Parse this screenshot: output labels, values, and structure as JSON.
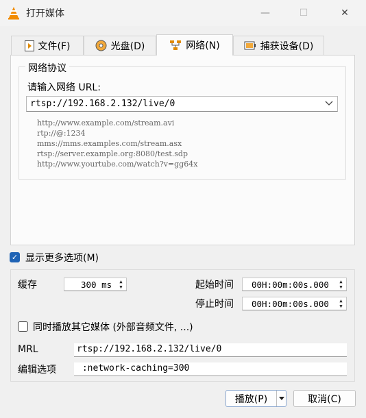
{
  "window": {
    "title": "打开媒体",
    "minimize": "—",
    "maximize": "☐",
    "close": "✕"
  },
  "tabs": [
    {
      "label": "文件(F)",
      "icon": "file-play-icon"
    },
    {
      "label": "光盘(D)",
      "icon": "disc-icon"
    },
    {
      "label": "网络(N)",
      "icon": "network-icon",
      "active": true
    },
    {
      "label": "捕获设备(D)",
      "icon": "capture-device-icon"
    }
  ],
  "network": {
    "group_title": "网络协议",
    "url_label": "请输入网络 URL:",
    "url_value": "rtsp://192.168.2.132/live/0",
    "examples": [
      "http://www.example.com/stream.avi",
      "rtp://@:1234",
      "mms://mms.examples.com/stream.asx",
      "rtsp://server.example.org:8080/test.sdp",
      "http://www.yourtube.com/watch?v=gg64x"
    ]
  },
  "options": {
    "show_more_label": "显示更多选项(M)",
    "show_more_checked": true,
    "cache_label": "缓存",
    "cache_value": "300 ms",
    "start_time_label": "起始时间",
    "start_time_value": "00H:00m:00s.000",
    "stop_time_label": "停止时间",
    "stop_time_value": "00H:00m:00s.000",
    "play_another_label": "同时播放其它媒体 (外部音频文件, ...)",
    "play_another_checked": false,
    "mrl_label": "MRL",
    "mrl_value": "rtsp://192.168.2.132/live/0",
    "edit_label": "编辑选项",
    "edit_value": " :network-caching=300"
  },
  "buttons": {
    "play": "播放(P)",
    "cancel": "取消(C)"
  },
  "colors": {
    "accent": "#1f63b5",
    "vlc_orange": "#f28c00"
  }
}
